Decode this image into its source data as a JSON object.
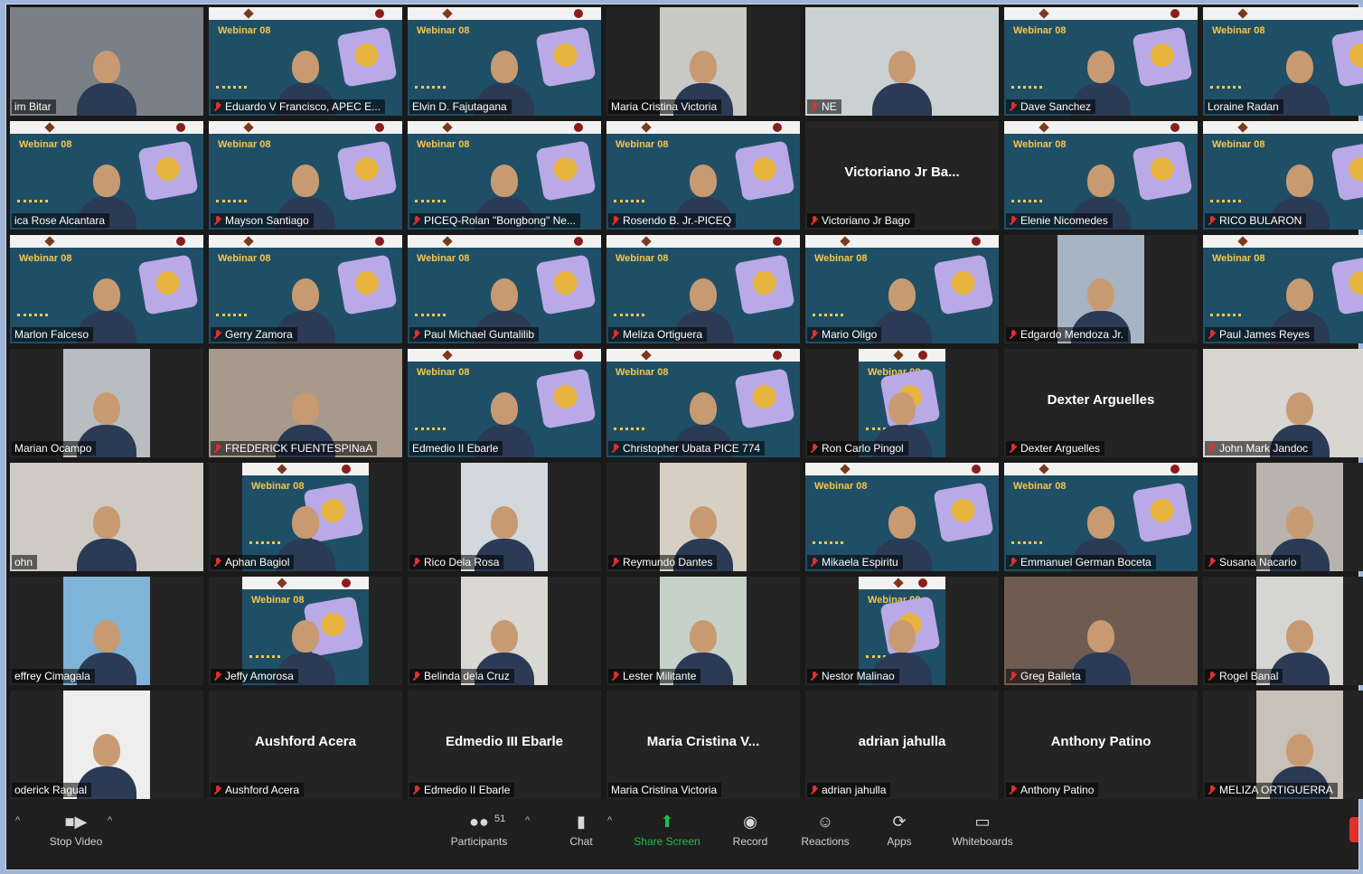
{
  "meeting": {
    "tiles": [
      {
        "name": "Tim Bitar",
        "display": "im Bitar",
        "muted": false,
        "kind": "video",
        "shape": "full",
        "tone": "#7b7f86"
      },
      {
        "name": "Eduardo V Francisco, APEC E...",
        "display": "Eduardo V Francisco, APEC E...",
        "muted": true,
        "kind": "banner",
        "shape": "full"
      },
      {
        "name": "Elvin D. Fajutagana",
        "display": "Elvin D. Fajutagana",
        "muted": false,
        "kind": "banner",
        "shape": "full",
        "active": true
      },
      {
        "name": "Maria Cristina Victoria",
        "display": "Maria Cristina Victoria",
        "muted": false,
        "kind": "video",
        "shape": "narrow",
        "tone": "#c8c8c4"
      },
      {
        "name": "NE",
        "display": "NE",
        "muted": true,
        "kind": "video",
        "shape": "full",
        "tone": "#cbd0d2"
      },
      {
        "name": "Dave Sanchez",
        "display": "Dave Sanchez",
        "muted": true,
        "kind": "banner",
        "shape": "full"
      },
      {
        "name": "Loraine Radan",
        "display": "Loraine Radan",
        "muted": false,
        "kind": "banner",
        "shape": "full"
      },
      {
        "name": "Erica Rose Alcantara",
        "display": "ica Rose Alcantara",
        "muted": false,
        "kind": "banner",
        "shape": "full"
      },
      {
        "name": "Mayson Santiago",
        "display": "Mayson Santiago",
        "muted": true,
        "kind": "banner",
        "shape": "full"
      },
      {
        "name": "PICEQ-Rolan \"Bongbong\" Ne...",
        "display": "PICEQ-Rolan \"Bongbong\" Ne...",
        "muted": true,
        "kind": "banner",
        "shape": "full"
      },
      {
        "name": "Rosendo B. Jr.-PICEQ",
        "display": "Rosendo B. Jr.-PICEQ",
        "muted": true,
        "kind": "banner",
        "shape": "full"
      },
      {
        "name": "Victoriano Jr Bago",
        "display": "Victoriano Jr Bago",
        "muted": true,
        "kind": "name",
        "big": "Victoriano Jr Ba..."
      },
      {
        "name": "Elenie Nicomedes",
        "display": "Elenie Nicomedes",
        "muted": true,
        "kind": "banner",
        "shape": "full"
      },
      {
        "name": "RICO BULARON",
        "display": "RICO BULARON",
        "muted": true,
        "kind": "banner",
        "shape": "full"
      },
      {
        "name": "Marlon Falceso",
        "display": "Marlon Falceso",
        "muted": false,
        "kind": "banner",
        "shape": "full"
      },
      {
        "name": "Gerry Zamora",
        "display": "Gerry Zamora",
        "muted": true,
        "kind": "banner",
        "shape": "full"
      },
      {
        "name": "Paul Michael Guntalilib",
        "display": "Paul Michael Guntalilib",
        "muted": true,
        "kind": "banner",
        "shape": "full"
      },
      {
        "name": "Meliza Ortiguera",
        "display": "Meliza Ortiguera",
        "muted": true,
        "kind": "banner",
        "shape": "full"
      },
      {
        "name": "Mario Oligo",
        "display": "Mario Oligo",
        "muted": true,
        "kind": "banner",
        "shape": "full"
      },
      {
        "name": "Edgardo Mendoza Jr.",
        "display": "Edgardo Mendoza Jr.",
        "muted": true,
        "kind": "video",
        "shape": "narrow",
        "tone": "#a7b4c4"
      },
      {
        "name": "Paul James Reyes",
        "display": "Paul James Reyes",
        "muted": true,
        "kind": "banner",
        "shape": "full"
      },
      {
        "name": "Marian Ocampo",
        "display": "Marian Ocampo",
        "muted": false,
        "kind": "video",
        "shape": "narrow",
        "tone": "#b9bdc2"
      },
      {
        "name": "FREDERICK FUENTESPINAA",
        "display": "FREDERICK FUENTESPINaA",
        "muted": true,
        "kind": "video",
        "shape": "full",
        "tone": "#a79a8c"
      },
      {
        "name": "Edmedio II Ebarle",
        "display": "Edmedio II Ebarle",
        "muted": false,
        "kind": "banner",
        "shape": "full"
      },
      {
        "name": "Christopher Ubata PICE 774",
        "display": "Christopher Ubata PICE 774",
        "muted": true,
        "kind": "banner",
        "shape": "full"
      },
      {
        "name": "Ron Carlo Pingol",
        "display": "Ron Carlo Pingol",
        "muted": true,
        "kind": "banner",
        "shape": "narrow"
      },
      {
        "name": "Dexter Arguelles",
        "display": "Dexter Arguelles",
        "muted": true,
        "kind": "name",
        "big": "Dexter Arguelles"
      },
      {
        "name": "John Mark Jandoc",
        "display": "John Mark Jandoc",
        "muted": true,
        "kind": "video",
        "shape": "full",
        "tone": "#d9d6d2"
      },
      {
        "name": "John",
        "display": "ohn",
        "muted": false,
        "kind": "video",
        "shape": "full",
        "tone": "#cfcac4"
      },
      {
        "name": "Aphan Bagiol",
        "display": "Aphan Bagiol",
        "muted": true,
        "kind": "banner",
        "shape": "wide"
      },
      {
        "name": "Rico Dela Rosa",
        "display": "Rico Dela Rosa",
        "muted": true,
        "kind": "video",
        "shape": "narrow",
        "tone": "#d3d8de"
      },
      {
        "name": "Reymundo Dantes",
        "display": "Reymundo Dantes",
        "muted": true,
        "kind": "video",
        "shape": "narrow",
        "tone": "#d6d0c4"
      },
      {
        "name": "Mikaela Espiritu",
        "display": "Mikaela Espiritu",
        "muted": true,
        "kind": "banner",
        "shape": "full"
      },
      {
        "name": "Emmanuel German Boceta",
        "display": "Emmanuel German Boceta",
        "muted": true,
        "kind": "banner",
        "shape": "full"
      },
      {
        "name": "Susana Nacario",
        "display": "Susana Nacario",
        "muted": true,
        "kind": "video",
        "shape": "narrow",
        "tone": "#b8b3ad"
      },
      {
        "name": "Jeffrey Cimagala",
        "display": "effrey Cimagala",
        "muted": false,
        "kind": "video",
        "shape": "narrow",
        "tone": "#7fb3d8"
      },
      {
        "name": "Jeffy Amorosa",
        "display": "Jeffy Amorosa",
        "muted": true,
        "kind": "banner",
        "shape": "wide"
      },
      {
        "name": "Belinda dela Cruz",
        "display": "Belinda dela Cruz",
        "muted": true,
        "kind": "video",
        "shape": "narrow",
        "tone": "#d9d8d2"
      },
      {
        "name": "Lester Militante",
        "display": "Lester Militante",
        "muted": true,
        "kind": "video",
        "shape": "narrow",
        "tone": "#c6d2c8"
      },
      {
        "name": "Nestor Malinao",
        "display": "Nestor Malinao",
        "muted": true,
        "kind": "banner",
        "shape": "narrow"
      },
      {
        "name": "Greg Balleta",
        "display": "Greg Balleta",
        "muted": true,
        "kind": "video",
        "shape": "full",
        "tone": "#6e5c52"
      },
      {
        "name": "Rogel Banal",
        "display": "Rogel Banal",
        "muted": true,
        "kind": "video",
        "shape": "narrow",
        "tone": "#d5d5d3"
      },
      {
        "name": "Roderick Ragual",
        "display": "oderick Ragual",
        "muted": false,
        "kind": "video",
        "shape": "narrow",
        "tone": "#eeeeee"
      },
      {
        "name": "Aushford Acera",
        "display": "Aushford Acera",
        "muted": true,
        "kind": "name",
        "big": "Aushford Acera"
      },
      {
        "name": "Edmedio II Ebarle",
        "display": "Edmedio II Ebarle",
        "muted": true,
        "kind": "name",
        "big": "Edmedio III Ebarle"
      },
      {
        "name": "Maria Cristina Victoria",
        "display": "Maria Cristina Victoria",
        "muted": false,
        "kind": "name",
        "big": "Maria  Cristina  V..."
      },
      {
        "name": "adrian jahulla",
        "display": "adrian jahulla",
        "muted": true,
        "kind": "name",
        "big": "adrian jahulla"
      },
      {
        "name": "Anthony Patino",
        "display": "Anthony Patino",
        "muted": true,
        "kind": "name",
        "big": "Anthony Patino"
      },
      {
        "name": "MELIZA ORTIGUERRA",
        "display": "MELIZA ORTIGUERRA",
        "muted": true,
        "kind": "video",
        "shape": "narrow",
        "tone": "#c7c1b9"
      }
    ],
    "banner_title": "Webinar 08"
  },
  "toolbar": {
    "stop_video": "Stop Video",
    "participants": "Participants",
    "participants_count": "51",
    "chat": "Chat",
    "share_screen": "Share Screen",
    "record": "Record",
    "reactions": "Reactions",
    "apps": "Apps",
    "whiteboards": "Whiteboards"
  },
  "colors": {
    "accent_share": "#1fbf4f",
    "mute_red": "#e0302d",
    "active_speaker": "#d7e23a"
  }
}
